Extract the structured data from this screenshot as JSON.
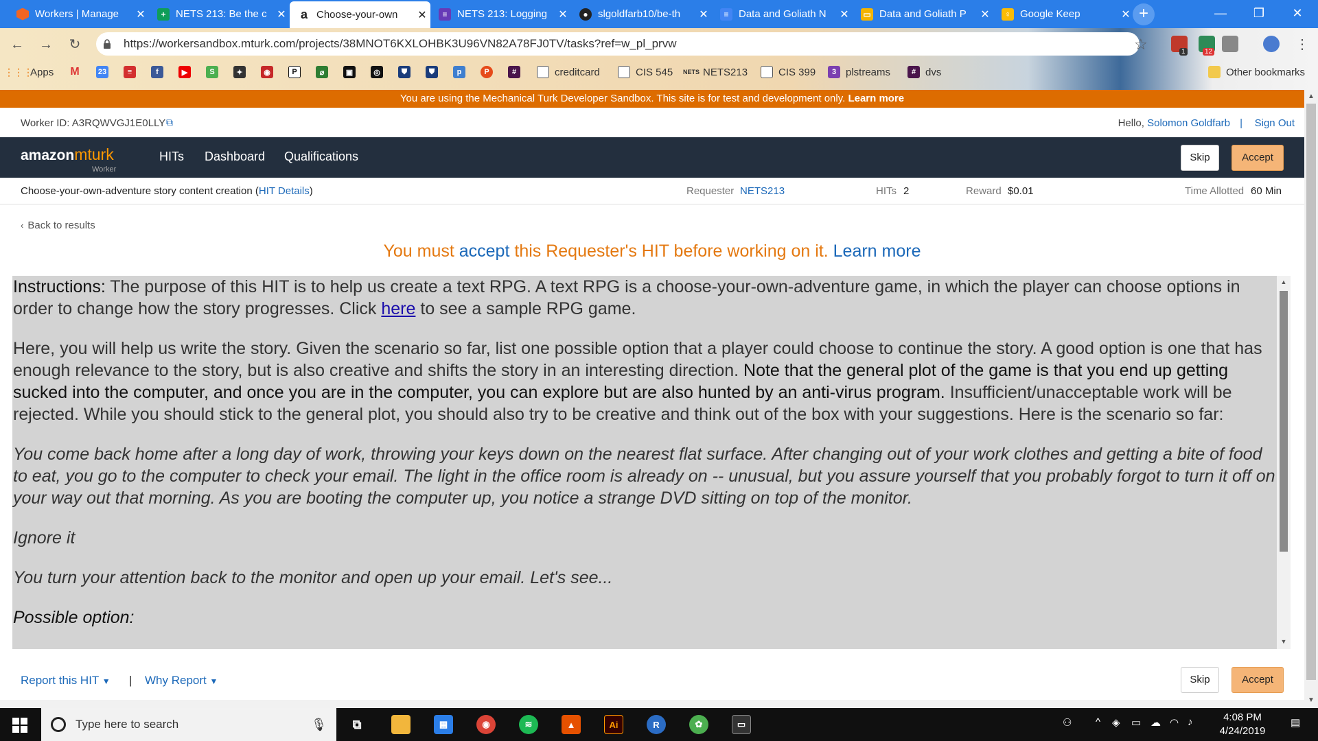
{
  "browser": {
    "tabs": [
      {
        "title": "Workers | Manage",
        "color": "#f26522",
        "glyph": ""
      },
      {
        "title": "NETS 213: Be the c",
        "color": "#0f9d58",
        "glyph": "+"
      },
      {
        "title": "Choose-your-own",
        "color": "#ffffff",
        "glyph": "a"
      },
      {
        "title": "NETS 213: Logging",
        "color": "#673ab7",
        "glyph": "≡"
      },
      {
        "title": "slgoldfarb10/be-th",
        "color": "#222222",
        "glyph": "●"
      },
      {
        "title": "Data and Goliath N",
        "color": "#4285f4",
        "glyph": "≡"
      },
      {
        "title": "Data and Goliath P",
        "color": "#f4b400",
        "glyph": "▭"
      },
      {
        "title": "Google Keep",
        "color": "#fbbc04",
        "glyph": "♀"
      }
    ],
    "url": "https://workersandbox.mturk.com/projects/38MNOT6KXLOHBK3U96VN82A78FJ0TV/tasks?ref=w_pl_prvw",
    "bookmarks": {
      "apps": "Apps",
      "creditcard": "creditcard",
      "cis545": "CIS 545",
      "nets213": "NETS213",
      "cis399": "CIS 399",
      "plstreams": "plstreams",
      "dvs": "dvs",
      "other": "Other bookmarks"
    },
    "ext_badges": {
      "b1": "1",
      "b2": "12"
    }
  },
  "sandbox_banner": {
    "text": "You are using the Mechanical Turk Developer Sandbox. This site is for test and development only.",
    "link": "Learn more"
  },
  "worker": {
    "id_label": "Worker ID: A3RQWVGJ1E0LLY",
    "hello": "Hello,",
    "name": "Solomon Goldfarb",
    "sep": "|",
    "signout": "Sign Out"
  },
  "header": {
    "logo_amazon": "amazon",
    "logo_mturk": "mturk",
    "logo_worker": "Worker",
    "nav": [
      "HITs",
      "Dashboard",
      "Qualifications"
    ],
    "skip": "Skip",
    "accept": "Accept"
  },
  "hit": {
    "title": "Choose-your-own-adventure story content creation",
    "details_open": "(",
    "details": "HIT Details",
    "details_close": ")",
    "requester_label": "Requester",
    "requester": "NETS213",
    "hits_label": "HITs",
    "hits": "2",
    "reward_label": "Reward",
    "reward": "$0.01",
    "time_label": "Time Allotted",
    "time": "60 Min"
  },
  "back": "Back to results",
  "must_accept": {
    "pre": "You must",
    "accept": "accept",
    "mid": "this Requester's HIT before working on it.",
    "learn": "Learn more"
  },
  "instructions": {
    "label": "Instructions:",
    "p1a": " The purpose of this HIT is to help us create a text RPG. A text RPG is a choose-your-own-adventure game, in which the player can choose options in order to change how the story progresses. Click ",
    "here": "here",
    "p1b": " to see a sample RPG game.",
    "p2a": "Here, you will help us write the story. Given the scenario so far, list one possible option that a player could choose to continue the story. A good option is one that has enough relevance to the story, but is also creative and shifts the story in an interesting direction. ",
    "p2b": "Note that the general plot of the game is that you end up getting sucked into the computer, and once you are in the computer, you can explore but are also hunted by an anti-virus program.",
    "p2c": " Insufficient/unacceptable work will be rejected. While you should stick to the general plot, you should also try to be creative and think out of the box with your suggestions. Here is the scenario so far:",
    "story": "You come back home after a long day of work, throwing your keys down on the nearest flat surface. After changing out of your work clothes and getting a bite of food to eat, you go to the computer to check your email. The light in the office room is already on -- unusual, but you assure yourself that you probably forgot to turn it off on your way out that morning. As you are booting the computer up, you notice a strange DVD sitting on top of the monitor.",
    "choice": "Ignore it",
    "result": "You turn your attention back to the monitor and open up your email. Let's see...",
    "possible": "Possible option:"
  },
  "footer": {
    "report": "Report this HIT",
    "sep": "|",
    "why": "Why Report",
    "skip": "Skip",
    "accept": "Accept"
  },
  "taskbar": {
    "search_placeholder": "Type here to search",
    "time": "4:08 PM",
    "date": "4/24/2019"
  }
}
